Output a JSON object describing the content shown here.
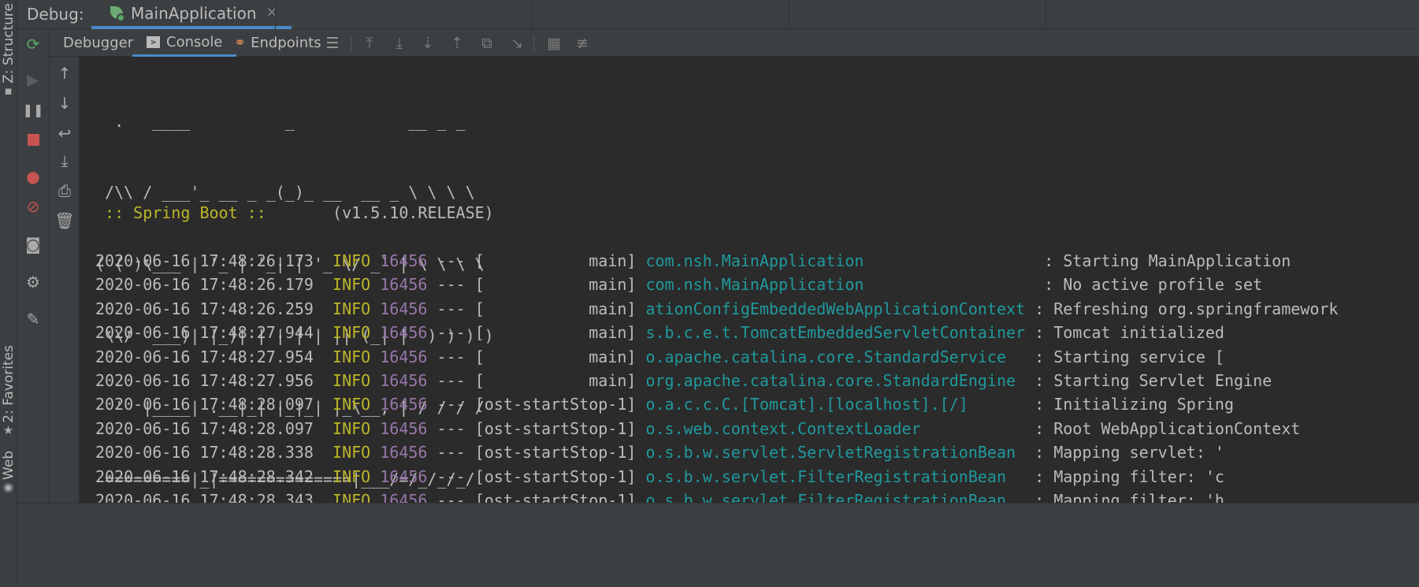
{
  "side_tabs": {
    "structure": "Z: Structure",
    "favorites": "2: Favorites",
    "web": "Web"
  },
  "debug_header": {
    "label": "Debug:",
    "run_config": "MainApplication",
    "close_icon": "close-icon"
  },
  "toolbar": {
    "debugger": "Debugger",
    "console": "Console",
    "endpoints": "Endpoints"
  },
  "banner": [
    "  .   ____          _            __ _ _",
    " /\\\\ / ___'_ __ _ _(_)_ __  __ _ \\ \\ \\ \\",
    "( ( )\\___ | '_ | '_| | '_ \\/ _` | \\ \\ \\ \\",
    " \\\\/  ___)| |_)| | | | | || (_| |  ) ) ) )",
    "  '  |____| .__|_| |_|_| |_\\__, | / / / /",
    " =========|_|==============|___/=/_/_/_/"
  ],
  "boot": {
    "spring_label": " :: Spring Boot :: ",
    "version": "      (v1.5.10.RELEASE)"
  },
  "log_lines": [
    {
      "ts": "2020-06-16 17:48:26.173",
      "lvl": "INFO",
      "pid": "16456",
      "thr": "[           main]",
      "lg": "com.nsh.MainApplication                  ",
      "msg": "Starting MainApplication"
    },
    {
      "ts": "2020-06-16 17:48:26.179",
      "lvl": "INFO",
      "pid": "16456",
      "thr": "[           main]",
      "lg": "com.nsh.MainApplication                  ",
      "msg": "No active profile set"
    },
    {
      "ts": "2020-06-16 17:48:26.259",
      "lvl": "INFO",
      "pid": "16456",
      "thr": "[           main]",
      "lg": "ationConfigEmbeddedWebApplicationContext",
      "msg": "Refreshing org.springframework"
    },
    {
      "ts": "2020-06-16 17:48:27.944",
      "lvl": "INFO",
      "pid": "16456",
      "thr": "[           main]",
      "lg": "s.b.c.e.t.TomcatEmbeddedServletContainer",
      "msg": "Tomcat initialized"
    },
    {
      "ts": "2020-06-16 17:48:27.954",
      "lvl": "INFO",
      "pid": "16456",
      "thr": "[           main]",
      "lg": "o.apache.catalina.core.StandardService  ",
      "msg": "Starting service ["
    },
    {
      "ts": "2020-06-16 17:48:27.956",
      "lvl": "INFO",
      "pid": "16456",
      "thr": "[           main]",
      "lg": "org.apache.catalina.core.StandardEngine ",
      "msg": "Starting Servlet Engine"
    },
    {
      "ts": "2020-06-16 17:48:28.097",
      "lvl": "INFO",
      "pid": "16456",
      "thr": "[ost-startStop-1]",
      "lg": "o.a.c.c.C.[Tomcat].[localhost].[/]      ",
      "msg": "Initializing Spring"
    },
    {
      "ts": "2020-06-16 17:48:28.097",
      "lvl": "INFO",
      "pid": "16456",
      "thr": "[ost-startStop-1]",
      "lg": "o.s.web.context.ContextLoader           ",
      "msg": "Root WebApplicationContext"
    },
    {
      "ts": "2020-06-16 17:48:28.338",
      "lvl": "INFO",
      "pid": "16456",
      "thr": "[ost-startStop-1]",
      "lg": "o.s.b.w.servlet.ServletRegistrationBean ",
      "msg": "Mapping servlet: '"
    },
    {
      "ts": "2020-06-16 17:48:28.342",
      "lvl": "INFO",
      "pid": "16456",
      "thr": "[ost-startStop-1]",
      "lg": "o.s.b.w.servlet.FilterRegistrationBean  ",
      "msg": "Mapping filter: 'c"
    },
    {
      "ts": "2020-06-16 17:48:28.343",
      "lvl": "INFO",
      "pid": "16456",
      "thr": "[ost-startStop-1]",
      "lg": "o.s.b.w.servlet.FilterRegistrationBean  ",
      "msg": "Mapping filter: 'h"
    }
  ],
  "colors": {
    "timestamp": "#bbbbbb",
    "level": "#bbb529",
    "pid": "#9876aa",
    "logger": "#20999d",
    "accent_tab": "#4a88c7"
  }
}
